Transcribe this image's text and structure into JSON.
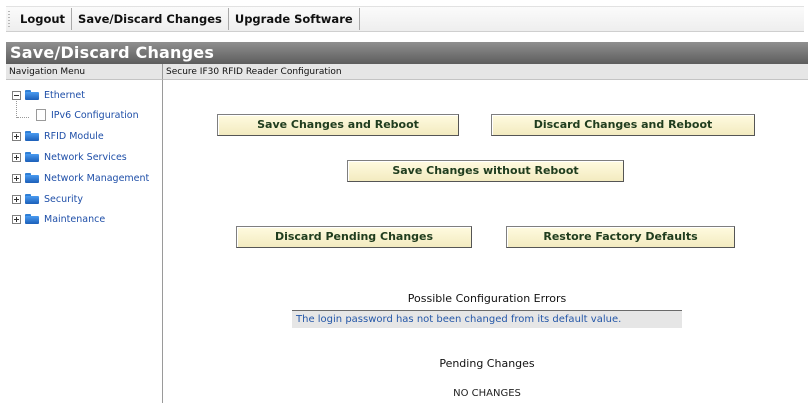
{
  "toolbar": {
    "items": [
      "Logout",
      "Save/Discard Changes",
      "Upgrade Software"
    ]
  },
  "title": "Save/Discard Changes",
  "columns": {
    "left": "Navigation Menu",
    "right": "Secure IF30 RFID Reader Configuration"
  },
  "nav": {
    "items": [
      {
        "label": "Ethernet",
        "expander": "minus",
        "icon": "folder-icon"
      },
      {
        "label": "IPv6 Configuration",
        "expander": "none",
        "icon": "page-icon"
      },
      {
        "label": "RFID Module",
        "expander": "plus",
        "icon": "folder-icon"
      },
      {
        "label": "Network Services",
        "expander": "plus",
        "icon": "folder-icon"
      },
      {
        "label": "Network Management",
        "expander": "plus",
        "icon": "folder-icon"
      },
      {
        "label": "Security",
        "expander": "plus",
        "icon": "folder-icon"
      },
      {
        "label": "Maintenance",
        "expander": "plus",
        "icon": "folder-icon"
      }
    ]
  },
  "buttons": {
    "save_reboot": "Save Changes and Reboot",
    "discard_reboot": "Discard Changes and Reboot",
    "save_no_reboot": "Save Changes without Reboot",
    "discard_pending": "Discard Pending Changes",
    "restore_defaults": "Restore Factory Defaults"
  },
  "errors": {
    "title": "Possible Configuration Errors",
    "message": "The login password has not been changed from its default value."
  },
  "pending": {
    "title": "Pending Changes",
    "status": "NO CHANGES"
  },
  "colors": {
    "title_bar": "#6f6f6f",
    "button_bg": "#f7f0c8",
    "button_text": "#203d1e",
    "link": "#1f4fa8",
    "error_text": "#2457a8"
  }
}
